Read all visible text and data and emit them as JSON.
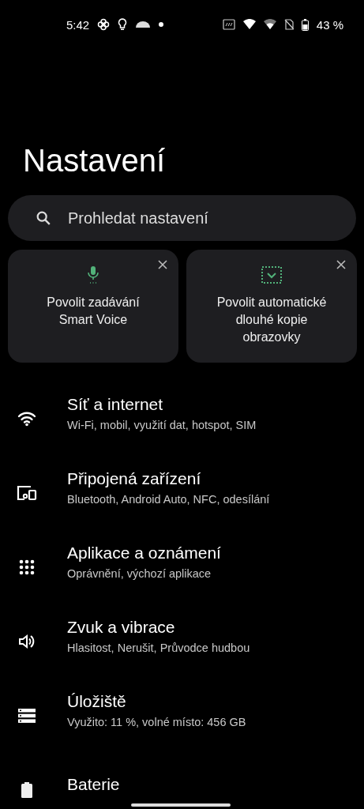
{
  "status_bar": {
    "time": "5:42",
    "battery": "43 %"
  },
  "title": "Nastavení",
  "search": {
    "placeholder": "Prohledat nastavení"
  },
  "suggestions": [
    {
      "kind": "mic",
      "text": "Povolit zadávání Smart Voice"
    },
    {
      "kind": "screenshot",
      "text": "Povolit automatické dlouhé kopie obrazovky"
    }
  ],
  "items": [
    {
      "kind": "wifi",
      "title": "Síť a internet",
      "summary": "Wi-Fi, mobil, využití dat, hotspot, SIM"
    },
    {
      "kind": "devices",
      "title": "Připojená zařízení",
      "summary": "Bluetooth, Android Auto, NFC, odesílání"
    },
    {
      "kind": "apps",
      "title": "Aplikace a oznámení",
      "summary": "Oprávnění, výchozí aplikace"
    },
    {
      "kind": "sound",
      "title": "Zvuk a vibrace",
      "summary": "Hlasitost, Nerušit, Průvodce hudbou"
    },
    {
      "kind": "storage",
      "title": "Úložiště",
      "summary": "Využito: 11 %, volné místo: 456 GB"
    },
    {
      "kind": "battery",
      "title": "Baterie"
    }
  ]
}
